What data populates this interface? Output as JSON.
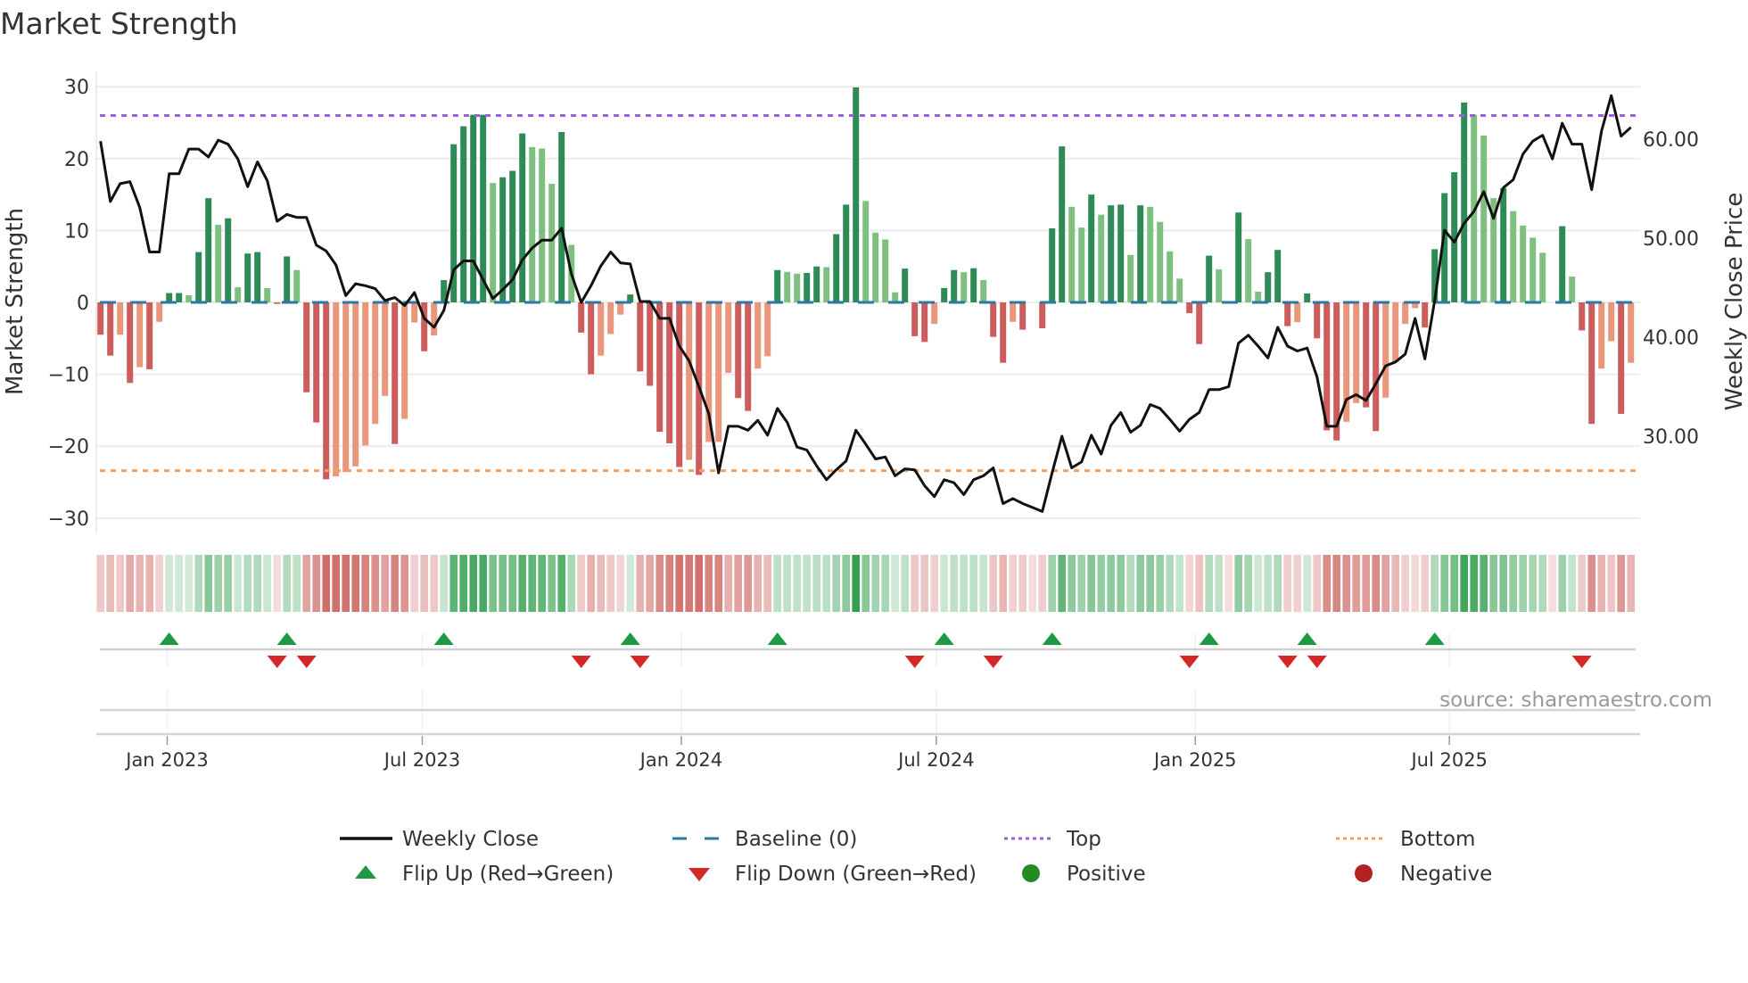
{
  "title": "Market Strength",
  "source": "source: sharemaestro.com",
  "colors": {
    "green_dark": "#2e8b57",
    "green_light": "#7fbf7f",
    "red_dark": "#cd5c5c",
    "red_light": "#e9967a",
    "baseline": "#2a77a8",
    "top": "#9b5fd8",
    "bottom": "#f0a060",
    "flip_up": "#1e9a44",
    "flip_down": "#d62728",
    "positive": "#228b22",
    "negative": "#b22222",
    "line": "#111111"
  },
  "chart_data": {
    "type": "bar",
    "title": "Market Strength",
    "ylabel": "Market Strength",
    "y2label": "Weekly Close Price",
    "ylim": [
      -32.5,
      32.5
    ],
    "y2lim": [
      20.3,
      67
    ],
    "y_ticks": [
      {
        "value": 30,
        "label": "30"
      },
      {
        "value": 20,
        "label": "20"
      },
      {
        "value": 10,
        "label": "10"
      },
      {
        "value": 0,
        "label": "0"
      },
      {
        "value": -10,
        "label": "−10"
      },
      {
        "value": -20,
        "label": "−20"
      },
      {
        "value": -30,
        "label": "−30"
      }
    ],
    "y2_ticks": [
      {
        "value": 60,
        "label": "60.00"
      },
      {
        "value": 50,
        "label": "50.00"
      },
      {
        "value": 40,
        "label": "40.00"
      },
      {
        "value": 30,
        "label": "30.00"
      }
    ],
    "x_ticks": [
      {
        "week": 7.8,
        "label": "Jan 2023"
      },
      {
        "week": 33.8,
        "label": "Jul 2023"
      },
      {
        "week": 60.2,
        "label": "Jan 2024"
      },
      {
        "week": 86.2,
        "label": "Jul 2024"
      },
      {
        "week": 112.6,
        "label": "Jan 2025"
      },
      {
        "week": 138.5,
        "label": "Jul 2025"
      }
    ],
    "top_level": 26,
    "bottom_level": -23.4,
    "baseline": 0,
    "strength": [
      -4.5,
      -7.4,
      -4.5,
      -11.2,
      -9,
      -9.3,
      -2.7,
      1.3,
      1.3,
      1.0,
      7.0,
      14.5,
      10.8,
      11.7,
      2.1,
      6.8,
      7.0,
      2.0,
      -0.2,
      6.4,
      4.5,
      -12.5,
      -16.7,
      -24.6,
      -24.2,
      -23.6,
      -22.8,
      -19.9,
      -16.9,
      -13.0,
      -19.7,
      -16.2,
      -2.8,
      -6.8,
      -4.6,
      3.1,
      22.0,
      24.5,
      26.1,
      26.1,
      16.6,
      17.4,
      18.3,
      23.5,
      21.6,
      21.4,
      16.5,
      23.7,
      8.0,
      -4.2,
      -10.0,
      -7.4,
      -4.4,
      -1.7,
      1.1,
      -9.6,
      -11.6,
      -18.0,
      -19.6,
      -22.9,
      -21.9,
      -24.0,
      -19.4,
      -19.4,
      -9.8,
      -13.3,
      -15.1,
      -9.2,
      -7.5,
      4.5,
      4.25,
      4.0,
      4.1,
      5.0,
      4.9,
      9.5,
      13.6,
      29.9,
      14.1,
      9.7,
      8.75,
      1.4,
      4.7,
      -4.7,
      -5.5,
      -3.0,
      2.0,
      4.5,
      4.2,
      4.75,
      3.1,
      -4.8,
      -8.4,
      -2.7,
      -3.8,
      0,
      -3.6,
      10.3,
      21.7,
      13.3,
      10.4,
      15.0,
      12.2,
      13.5,
      13.6,
      6.6,
      13.5,
      13.3,
      11.2,
      7.1,
      3.3,
      -1.5,
      -5.8,
      6.5,
      4.6,
      0,
      12.5,
      8.8,
      1.5,
      4.2,
      7.3,
      -3.3,
      -2.75,
      1.25,
      -5.0,
      -17.8,
      -19.2,
      -16.6,
      -14.0,
      -14.6,
      -17.9,
      -13.25,
      -8.25,
      -3.0,
      -0.8,
      -3.5,
      7.4,
      15.2,
      18.1,
      27.8,
      26.1,
      23.2,
      14.5,
      15.9,
      12.7,
      10.7,
      9.0,
      6.9,
      0,
      10.6,
      3.6,
      -3.9,
      -16.9,
      -9.2,
      -5.4,
      -15.5,
      -8.4
    ],
    "weekly_close": [
      59.8,
      53.7,
      55.5,
      55.7,
      53.1,
      48.6,
      48.6,
      56.5,
      56.5,
      59.0,
      59.0,
      58.2,
      59.9,
      59.5,
      58.0,
      55.2,
      57.7,
      55.8,
      51.7,
      52.4,
      52.1,
      52.1,
      49.3,
      48.7,
      47.3,
      44.2,
      45.4,
      45.2,
      44.9,
      43.7,
      44.0,
      43.2,
      44.5,
      41.9,
      41.0,
      42.7,
      46.8,
      47.7,
      47.7,
      45.8,
      43.9,
      44.8,
      45.8,
      47.8,
      49.0,
      49.8,
      49.8,
      51.0,
      46.4,
      43.5,
      45.2,
      47.2,
      48.6,
      47.5,
      47.4,
      43.6,
      43.6,
      41.9,
      41.9,
      39.1,
      37.6,
      35.0,
      32.3,
      26.3,
      31.0,
      31.0,
      30.6,
      31.6,
      30.1,
      32.8,
      31.4,
      28.9,
      28.6,
      27.0,
      25.6,
      26.6,
      27.5,
      30.6,
      29.2,
      27.7,
      27.9,
      26.0,
      26.7,
      26.6,
      25.0,
      23.9,
      25.6,
      25.3,
      24.1,
      25.6,
      26.0,
      26.8,
      23.2,
      23.7,
      23.2,
      22.8,
      22.4,
      26.3,
      30.0,
      26.8,
      27.4,
      30.1,
      28.2,
      31.1,
      32.4,
      30.4,
      31.1,
      33.2,
      32.8,
      31.7,
      30.5,
      31.7,
      32.4,
      34.7,
      34.7,
      35.0,
      39.4,
      40.2,
      39.1,
      37.9,
      41.0,
      39.1,
      38.6,
      38.9,
      36.0,
      31.0,
      31.0,
      33.7,
      34.2,
      33.6,
      35.3,
      37.1,
      37.5,
      38.3,
      41.9,
      37.8,
      43.7,
      50.8,
      49.6,
      51.5,
      52.7,
      54.7,
      52.0,
      55.1,
      55.9,
      58.5,
      59.8,
      60.4,
      58.0,
      61.6,
      59.5,
      59.5,
      54.9,
      60.8,
      64.4,
      60.3,
      61.2
    ],
    "legend": {
      "weekly_close": "Weekly Close",
      "baseline": "Baseline (0)",
      "top": "Top",
      "bottom": "Bottom",
      "flip_up": "Flip Up (Red→Green)",
      "flip_down": "Flip Down (Green→Red)",
      "positive": "Positive",
      "negative": "Negative"
    },
    "legend_placement": "bottom-center"
  }
}
